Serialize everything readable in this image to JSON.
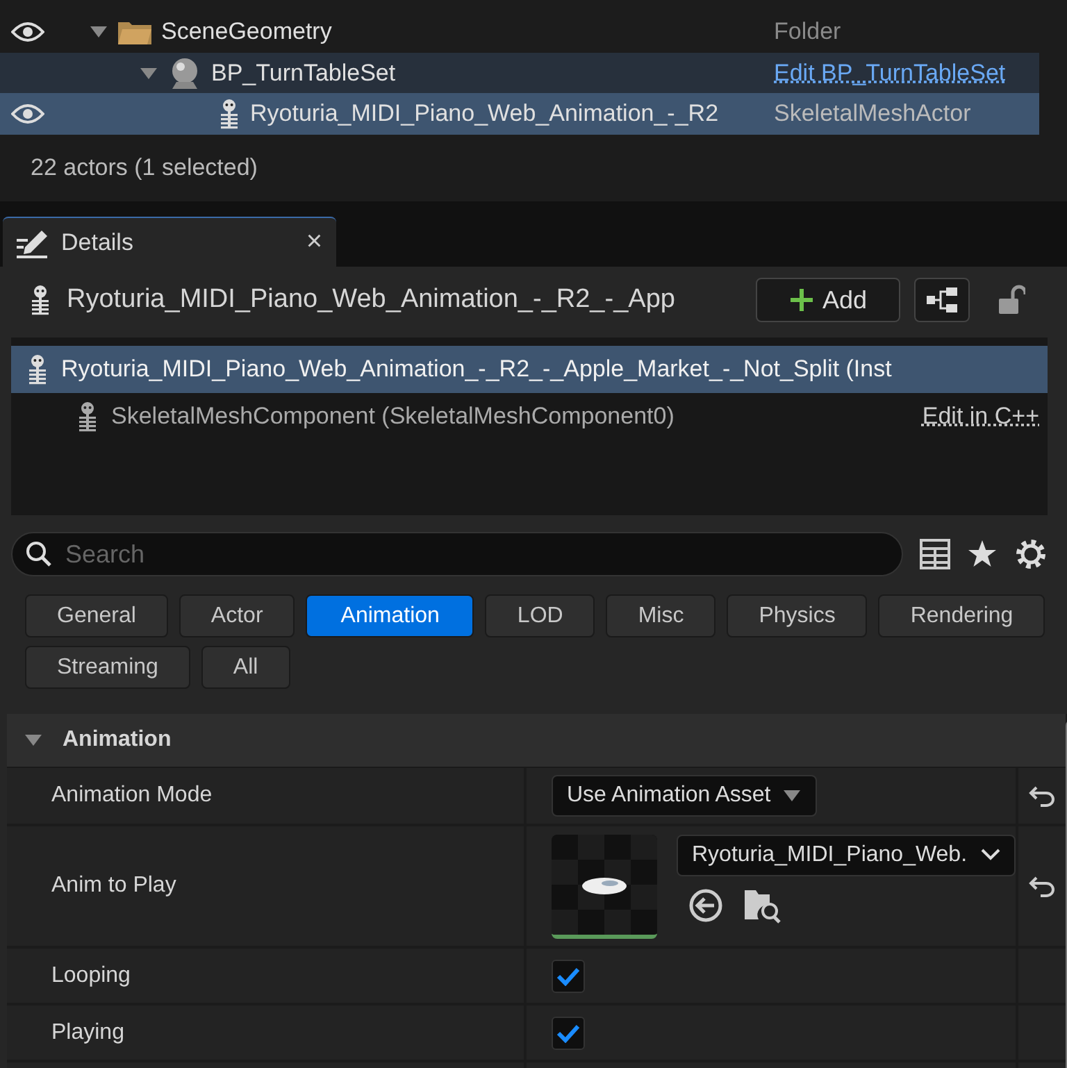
{
  "outliner": {
    "rows": [
      {
        "name": "SceneGeometry",
        "type": "Folder",
        "kind": "folder",
        "visible": true,
        "expanded": true,
        "highlighted": false,
        "selected": false,
        "children": [
          {
            "name": "BP_TurnTableSet",
            "type": "Edit BP_TurnTableSet",
            "kind": "blueprint",
            "visible": false,
            "expanded": true,
            "highlighted": true,
            "selected": false,
            "children": [
              {
                "name": "Ryoturia_MIDI_Piano_Web_Animation_-_R2",
                "type": "SkeletalMeshActor",
                "kind": "actor",
                "visible": true,
                "highlighted": false,
                "selected": true
              }
            ]
          }
        ]
      }
    ],
    "status": "22 actors (1 selected)"
  },
  "details": {
    "tab": {
      "title": "Details",
      "close": "×"
    },
    "actor_name": "Ryoturia_MIDI_Piano_Web_Animation_-_R2_-_App",
    "add_button": "Add",
    "locked": false,
    "components": [
      {
        "label": "Ryoturia_MIDI_Piano_Web_Animation_-_R2_-_Apple_Market_-_Not_Split (Inst",
        "selected": true,
        "children": [
          {
            "label": "SkeletalMeshComponent (SkeletalMeshComponent0)",
            "link": "Edit in C++",
            "selected": false
          }
        ]
      }
    ],
    "search": {
      "placeholder": "Search"
    },
    "filters": [
      {
        "label": "General",
        "selected": false
      },
      {
        "label": "Actor",
        "selected": false
      },
      {
        "label": "Animation",
        "selected": true
      },
      {
        "label": "LOD",
        "selected": false
      },
      {
        "label": "Misc",
        "selected": false
      },
      {
        "label": "Physics",
        "selected": false
      },
      {
        "label": "Rendering",
        "selected": false
      },
      {
        "label": "Streaming",
        "selected": false
      },
      {
        "label": "All",
        "selected": false
      }
    ],
    "section": {
      "title": "Animation",
      "expanded": true
    },
    "properties": [
      {
        "label": "Animation Mode",
        "kind": "combo",
        "value": "Use Animation Asset",
        "resettable": true
      },
      {
        "label": "Anim to Play",
        "kind": "asset",
        "value": "Ryoturia_MIDI_Piano_Web.",
        "resettable": true
      },
      {
        "label": "Looping",
        "kind": "checkbox",
        "checked": true,
        "resettable": false
      },
      {
        "label": "Playing",
        "kind": "checkbox",
        "checked": true,
        "resettable": false
      }
    ]
  }
}
